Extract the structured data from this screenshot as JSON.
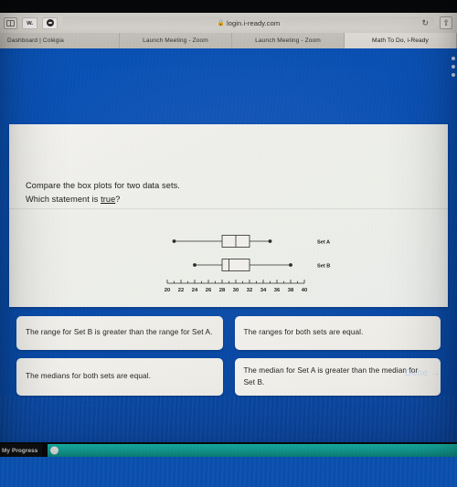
{
  "browser": {
    "sidebar_icon": "sidebar-toggle-icon",
    "favicon_text": "w.",
    "url": "login.i-ready.com",
    "lock_icon": "lock-icon",
    "reload_icon": "reload-icon",
    "share_icon": "share-icon",
    "tabs": [
      {
        "label": "Dashboard | Colégia",
        "active": false
      },
      {
        "label": "Launch Meeting - Zoom",
        "active": false
      },
      {
        "label": "Launch Meeting - Zoom",
        "active": false
      },
      {
        "label": "Math To Do, i-Ready",
        "active": true
      }
    ]
  },
  "question": {
    "line1": "Compare the box plots for two data sets.",
    "line2_pre": "Which statement is ",
    "line2_underlined": "true",
    "line2_post": "?"
  },
  "choices": [
    {
      "id": "choice-a",
      "text": "The range for Set B is greater than the range for Set A."
    },
    {
      "id": "choice-b",
      "text": "The ranges for both sets are equal."
    },
    {
      "id": "choice-c",
      "text": "The medians for both sets are equal."
    },
    {
      "id": "choice-d",
      "text": "The median for Set A is greater than the median for Set B."
    }
  ],
  "done_button": {
    "label": "Done →"
  },
  "progress": {
    "label": "My Progress",
    "accent_color": "#14aea4"
  },
  "chart_data": {
    "type": "box",
    "title": "",
    "xlabel": "",
    "ylabel": "",
    "xlim": [
      20,
      40
    ],
    "xticks": [
      20,
      22,
      24,
      26,
      28,
      30,
      32,
      34,
      36,
      38,
      40
    ],
    "xtick_labels": [
      "20",
      "22",
      "24",
      "26",
      "28",
      "30",
      "32",
      "34",
      "36",
      "38",
      "40"
    ],
    "minor_tick_step": 1,
    "grid": false,
    "legend_position": "right",
    "series": [
      {
        "name": "Set A",
        "min": 21,
        "q1": 28,
        "median": 30,
        "q3": 32,
        "max": 35
      },
      {
        "name": "Set B",
        "min": 24,
        "q1": 28,
        "median": 29,
        "q3": 32,
        "max": 38
      }
    ]
  }
}
